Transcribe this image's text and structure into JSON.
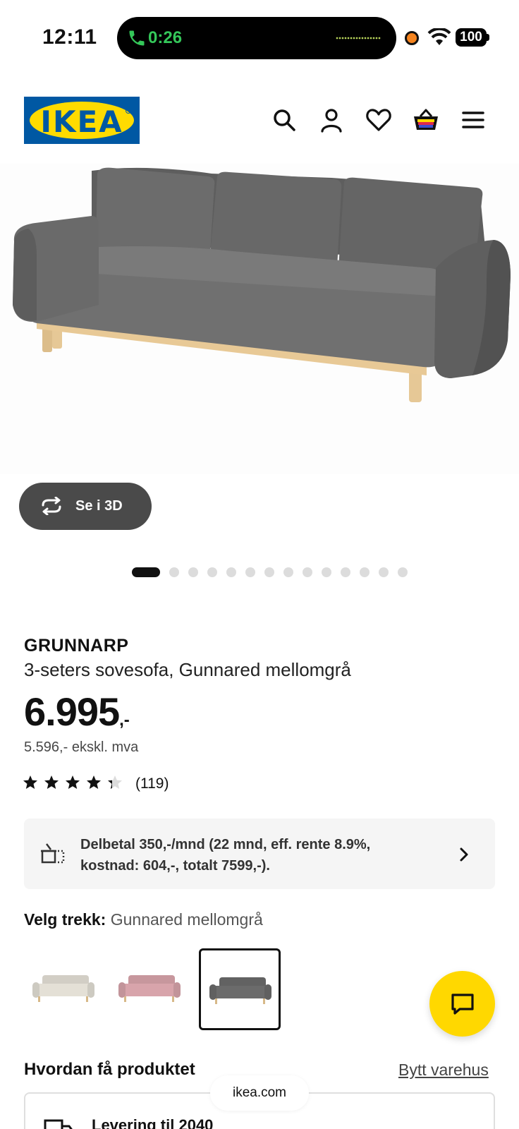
{
  "status_bar": {
    "time": "12:11",
    "call_duration": "0:26",
    "battery": "100"
  },
  "header": {
    "logo_text": "IKEA",
    "icons": [
      "search-icon",
      "account-icon",
      "heart-icon",
      "cart-icon",
      "menu-icon"
    ]
  },
  "hero": {
    "view_3d_label": "Se i 3D",
    "carousel_total": 14,
    "carousel_active_index": 0
  },
  "product": {
    "name": "GRUNNARP",
    "description": "3-seters sovesofa, Gunnared mellomgrå",
    "price": "6.995",
    "price_suffix": ",-",
    "price_excl_vat": "5.596,- ekskl. mva",
    "rating": 4.3,
    "rating_max": 5,
    "rating_count": "(119)"
  },
  "finance": {
    "text": "Delbetal 350,-/mnd (22 mnd, eff. rente 8.9%, kostnad: 604,-, totalt 7599,-)."
  },
  "cover": {
    "label": "Velg trekk:",
    "selected_value": "Gunnared mellomgrå",
    "options": [
      {
        "color": "#e4e0d6"
      },
      {
        "color": "#d8a4ab"
      },
      {
        "color": "#6b6b6b"
      }
    ],
    "selected_index": 2
  },
  "get_product": {
    "title": "Hvordan få produktet",
    "change_store_link": "Bytt varehus",
    "delivery_text": "Levering til 2040"
  },
  "browser": {
    "url": "ikea.com"
  },
  "colors": {
    "ikea_blue": "#0058a3",
    "ikea_yellow": "#ffdb00",
    "call_green": "#34c759"
  }
}
